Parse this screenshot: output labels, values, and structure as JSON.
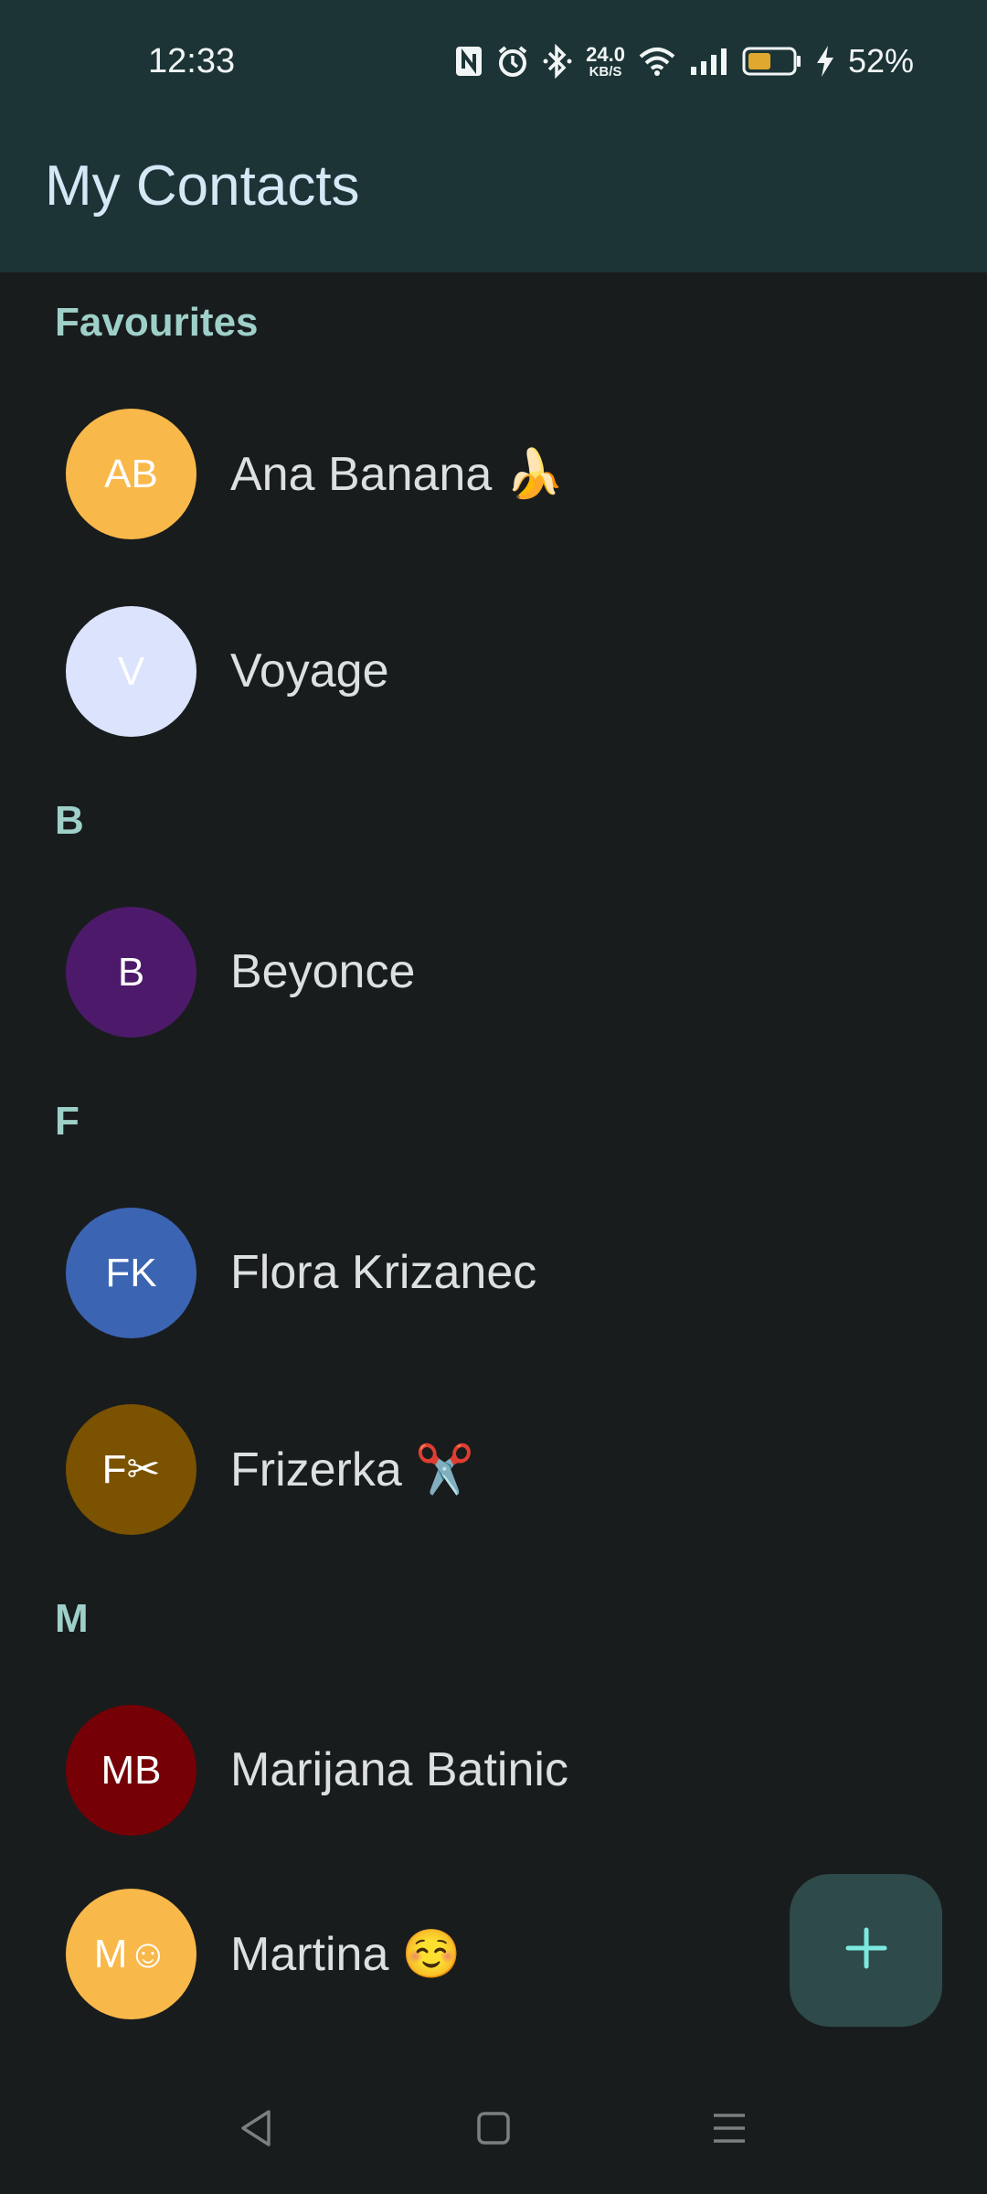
{
  "status_bar": {
    "time": "12:33",
    "net_speed_value": "24.0",
    "net_speed_unit": "KB/S",
    "battery_percent": "52%",
    "battery_level": 0.52,
    "icons": [
      "nfc-icon",
      "alarm-icon",
      "bluetooth-icon",
      "wifi-icon",
      "signal-icon",
      "battery-icon",
      "charging-icon"
    ]
  },
  "app_bar": {
    "title": "My Contacts"
  },
  "sections": [
    {
      "header": "Favourites",
      "contacts": [
        {
          "initials": "AB",
          "name": "Ana Banana 🍌",
          "color": "#f9b84a"
        },
        {
          "initials": "V",
          "name": "Voyage",
          "color": "#dbe3fd"
        }
      ]
    },
    {
      "header": "B",
      "contacts": [
        {
          "initials": "B",
          "name": "Beyonce",
          "color": "#4d1a6b"
        }
      ]
    },
    {
      "header": "F",
      "contacts": [
        {
          "initials": "FK",
          "name": "Flora Krizanec",
          "color": "#3b64b3"
        },
        {
          "initials": "F✂",
          "name": "Frizerka ✂️",
          "color": "#7b5200"
        }
      ]
    },
    {
      "header": "M",
      "contacts": [
        {
          "initials": "MB",
          "name": "Marijana Batinic",
          "color": "#750006"
        },
        {
          "initials": "M☺",
          "name": "Martina ☺️",
          "color": "#f9b84a"
        }
      ]
    }
  ],
  "fab": {
    "icon": "plus-icon",
    "color": "#7ce9e0"
  },
  "nav_bar": {
    "icons": [
      "back-icon",
      "home-icon",
      "recents-icon"
    ]
  }
}
